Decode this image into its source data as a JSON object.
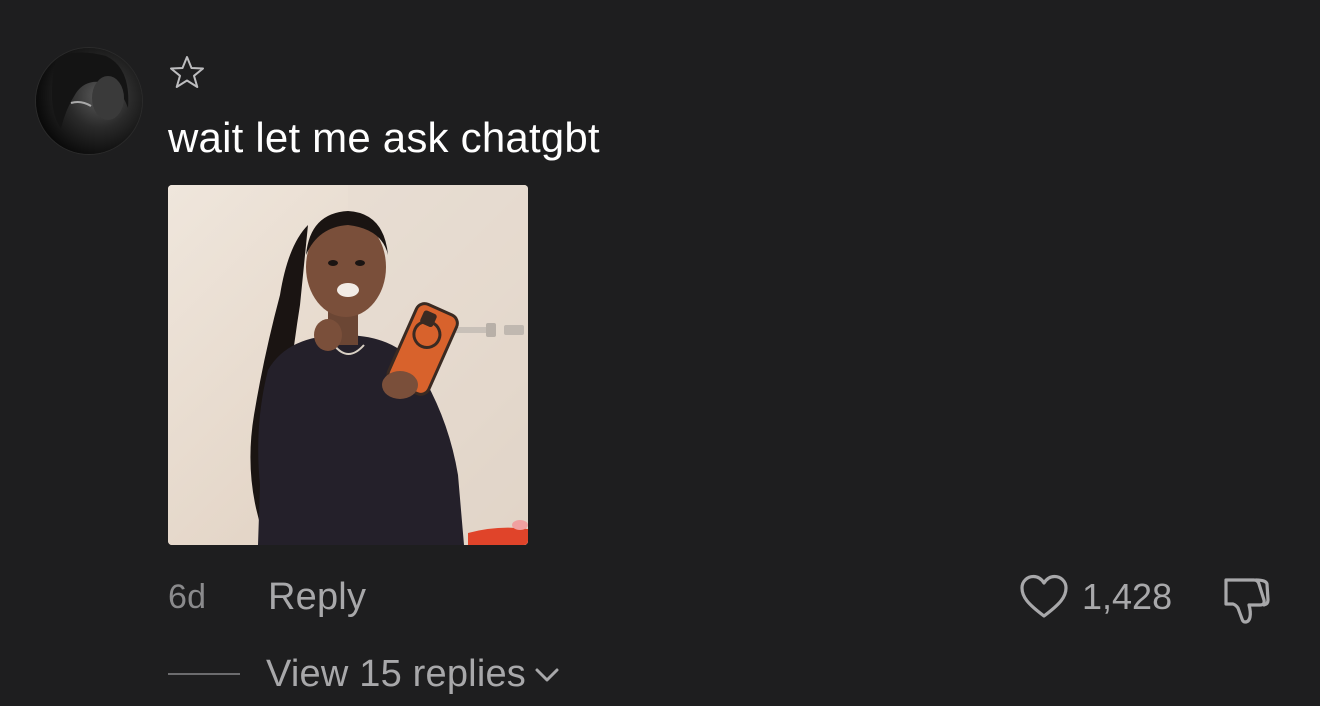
{
  "comment": {
    "avatar_icon": "user-avatar-dark-photo",
    "star_icon": "star-outline-icon",
    "text": "wait let me ask chatgbt",
    "image_description_icon": "attached-photo",
    "timestamp": "6d",
    "reply_label": "Reply",
    "like_icon": "heart-outline-icon",
    "like_count": "1,428",
    "dislike_icon": "thumbs-down-outline-icon",
    "view_replies_label": "View 15 replies",
    "chevron_icon": "chevron-down-icon"
  },
  "colors": {
    "background": "#1e1e1f",
    "primary_text": "#ffffff",
    "secondary_text": "#a8a8aa",
    "muted_text": "#8a8a8c"
  }
}
